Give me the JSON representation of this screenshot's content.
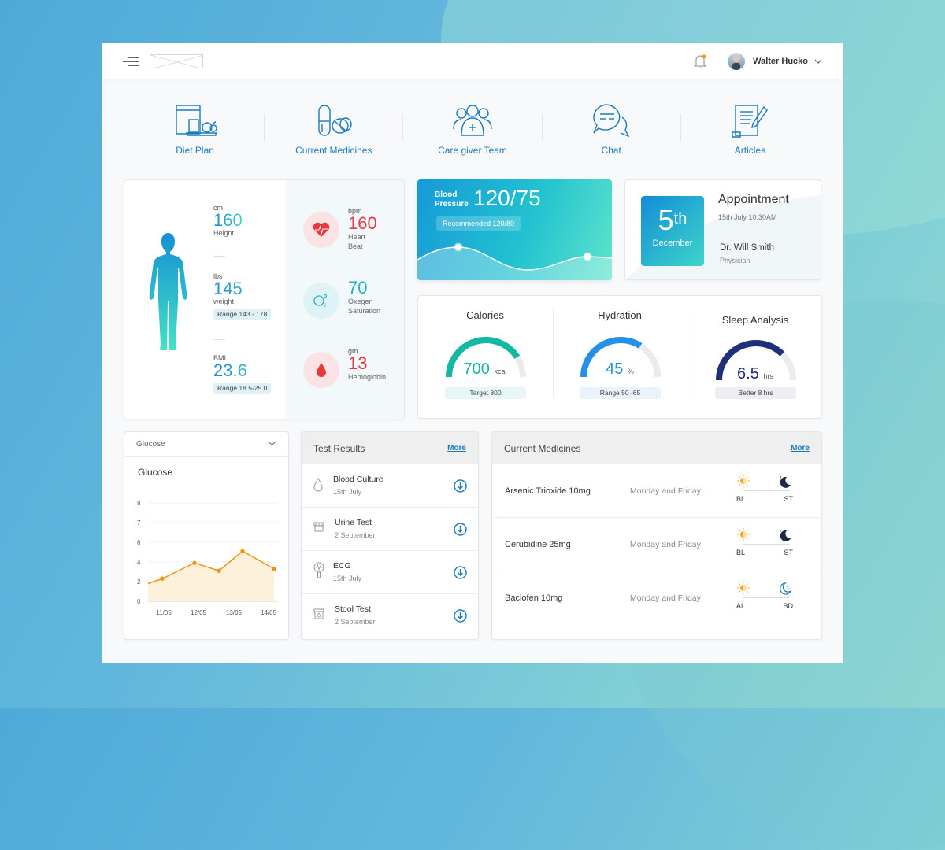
{
  "header": {
    "user_name": "Walter Hucko",
    "notification_dot_color": "#f39c12"
  },
  "quick_nav": [
    {
      "label": "Diet Plan",
      "icon": "diet-plan-icon"
    },
    {
      "label": "Current Medicines",
      "icon": "pills-icon"
    },
    {
      "label": "Care giver Team",
      "icon": "care-team-icon"
    },
    {
      "label": "Chat",
      "icon": "chat-icon"
    },
    {
      "label": "Articles",
      "icon": "article-icon"
    }
  ],
  "body_stats": {
    "height": {
      "unit": "cm",
      "value": "160",
      "label": "Height"
    },
    "weight": {
      "unit": "lbs",
      "value": "145",
      "label": "weight",
      "range": "Range 143 - 178"
    },
    "bmi": {
      "unit": "BMI",
      "value": "23.6",
      "range": "Range 18.5-25.0"
    }
  },
  "vitals": {
    "heart": {
      "unit": "bpm",
      "value": "160",
      "label": "Heart Beat",
      "color": "#e8383d"
    },
    "oxygen": {
      "unit": "",
      "value": "70",
      "label1": "Oxegen",
      "label2": "Saturation",
      "color": "#1fb5c4"
    },
    "hemoglobin": {
      "unit": "gm",
      "value": "13",
      "label": "Hemoglobin",
      "color": "#e8383d"
    }
  },
  "blood_pressure": {
    "label1": "Blood",
    "label2": "Pressure",
    "value": "120/75",
    "recommended": "Recommended 120/80"
  },
  "appointment": {
    "day": "5",
    "suffix": "th",
    "month": "December",
    "title": "Appointment",
    "time": "15th July 10:30AM",
    "doctor": "Dr. Will Smith",
    "role": "Physician"
  },
  "gauges": [
    {
      "title": "Calories",
      "value": "700",
      "unit": "kcal",
      "pill": "Target 800",
      "fraction": 0.82,
      "color": "#13b8a4",
      "pill_bg": "#e8f7f5"
    },
    {
      "title": "Hydration",
      "value": "45",
      "unit": "%",
      "pill": "Range 50 -65",
      "fraction": 0.68,
      "color": "#2590e8",
      "pill_bg": "#eaf3fc"
    },
    {
      "title": "Sleep Analysis",
      "value": "6.5",
      "unit": "hrs",
      "pill": "Better 8 hrs",
      "fraction": 0.75,
      "color": "#1f2f7a",
      "pill_bg": "#eceef3"
    }
  ],
  "glucose": {
    "dropdown": "Glucose",
    "title": "Glucose"
  },
  "chart_data": {
    "type": "area",
    "title": "Glucose",
    "x": [
      "10/05",
      "11/05",
      "12/05",
      "12.6/05",
      "13/05",
      "14/05"
    ],
    "tick_labels": [
      "11/05",
      "12/05",
      "13/05",
      "14/05"
    ],
    "y_ticks": [
      "0",
      "2",
      "4",
      "6",
      "7",
      "8"
    ],
    "series": [
      {
        "name": "Glucose",
        "values": [
          1.8,
          2.3,
          3.9,
          3.1,
          5.1,
          3.3
        ],
        "color": "#f29412"
      }
    ]
  },
  "test_results": {
    "title": "Test Results",
    "more": "More",
    "items": [
      {
        "name": "Blood Culture",
        "date": "15th July"
      },
      {
        "name": "Urine Test",
        "date": "2 September"
      },
      {
        "name": "ECG",
        "date": "15th July"
      },
      {
        "name": "Stool Test",
        "date": "2 September"
      }
    ]
  },
  "current_medicines": {
    "title": "Current Medicines",
    "more": "More",
    "items": [
      {
        "name": "Arsenic Trioxide 10mg",
        "days": "Monday and Friday",
        "t1": "BL",
        "t2": "ST"
      },
      {
        "name": "Cerubidine 25mg",
        "days": "Monday and Friday",
        "t1": "BL",
        "t2": "ST"
      },
      {
        "name": "Baclofen 10mg",
        "days": "Monday and Friday",
        "t1": "AL",
        "t2": "BD"
      }
    ]
  }
}
